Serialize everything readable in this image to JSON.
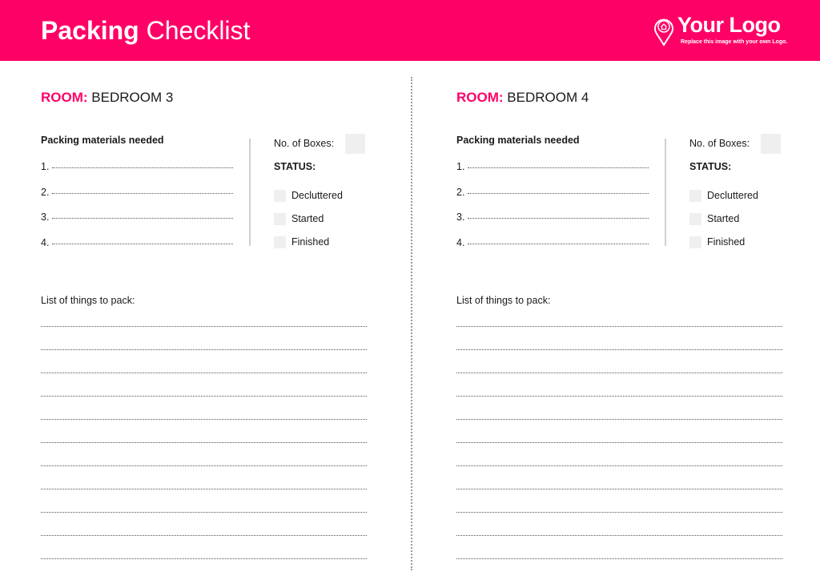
{
  "header": {
    "title_bold": "Packing",
    "title_rest": "Checklist",
    "brand_color": "#ff0066",
    "logo": {
      "icon": "map-pin-house-icon",
      "text": "Your Logo",
      "subtext": "Replace this image with your own Logo."
    }
  },
  "rooms": [
    {
      "room_label": "ROOM:",
      "room_name": "BEDROOM 3",
      "materials_heading": "Packing materials needed",
      "materials": [
        "1.",
        "2.",
        "3.",
        "4."
      ],
      "boxes_label": "No. of Boxes:",
      "boxes_value": "",
      "status_heading": "STATUS:",
      "status_options": [
        {
          "label": "Decluttered",
          "checked": false
        },
        {
          "label": "Started",
          "checked": false
        },
        {
          "label": "Finished",
          "checked": false
        }
      ],
      "list_heading": "List of things to pack:",
      "list_lines": [
        "",
        "",
        "",
        "",
        "",
        "",
        "",
        "",
        "",
        "",
        ""
      ]
    },
    {
      "room_label": "ROOM:",
      "room_name": "BEDROOM 4",
      "materials_heading": "Packing materials needed",
      "materials": [
        "1.",
        "2.",
        "3.",
        "4."
      ],
      "boxes_label": "No. of Boxes:",
      "boxes_value": "",
      "status_heading": "STATUS:",
      "status_options": [
        {
          "label": "Decluttered",
          "checked": false
        },
        {
          "label": "Started",
          "checked": false
        },
        {
          "label": "Finished",
          "checked": false
        }
      ],
      "list_heading": "List of things to pack:",
      "list_lines": [
        "",
        "",
        "",
        "",
        "",
        "",
        "",
        "",
        "",
        "",
        ""
      ]
    }
  ]
}
